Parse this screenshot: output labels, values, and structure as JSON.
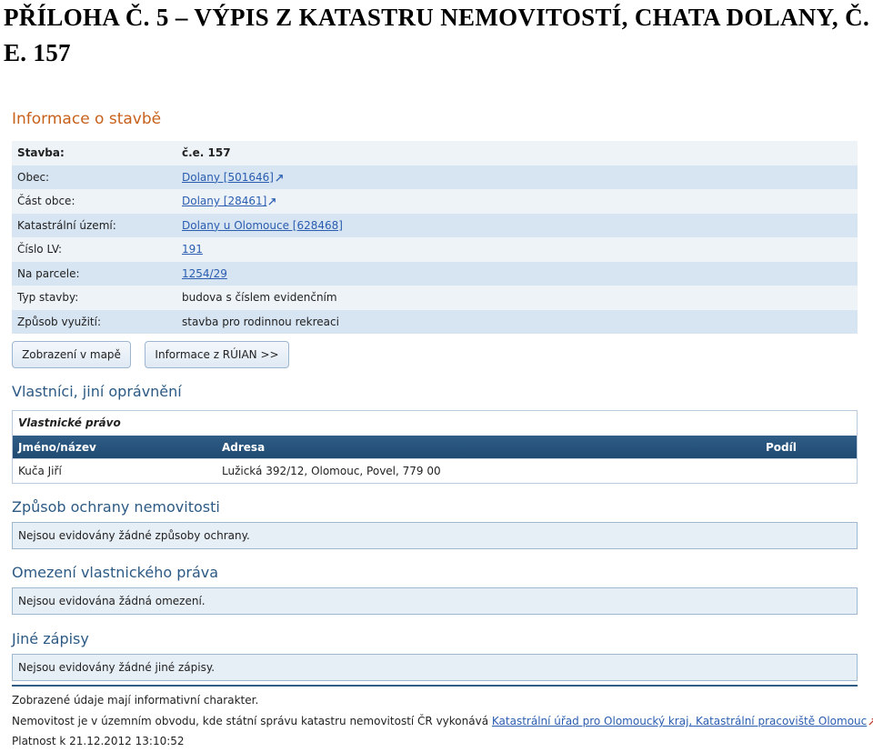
{
  "document": {
    "title": "PŘÍLOHA Č. 5 – VÝPIS Z KATASTRU NEMOVITOSTÍ, CHATA DOLANY, Č. E. 157"
  },
  "building_info": {
    "heading": "Informace o stavbě",
    "rows": [
      {
        "label": "Stavba:",
        "value": "č.e. 157",
        "link": false
      },
      {
        "label": "Obec:",
        "value": "Dolany [501646]",
        "link": true,
        "ext": true
      },
      {
        "label": "Část obce:",
        "value": "Dolany [28461]",
        "link": true,
        "ext": true
      },
      {
        "label": "Katastrální území:",
        "value": "Dolany u Olomouce [628468]",
        "link": true,
        "ext": false
      },
      {
        "label": "Číslo LV:",
        "value": "191",
        "link": true,
        "ext": false
      },
      {
        "label": "Na parcele:",
        "value": "1254/29",
        "link": true,
        "ext": false
      },
      {
        "label": "Typ stavby:",
        "value": "budova s číslem evidenčním",
        "link": false
      },
      {
        "label": "Způsob využití:",
        "value": "stavba pro rodinnou rekreaci",
        "link": false
      }
    ]
  },
  "buttons": {
    "map_label": "Zobrazení v mapě",
    "ruian_label": "Informace z RÚIAN >>"
  },
  "owners": {
    "heading": "Vlastníci, jiní oprávnění",
    "caption": "Vlastnické právo",
    "columns": [
      "Jméno/název",
      "Adresa",
      "Podíl"
    ],
    "rows": [
      {
        "name": "Kuča Jiří",
        "address": "Lužická 392/12, Olomouc, Povel, 779 00",
        "share": ""
      }
    ]
  },
  "protection": {
    "heading": "Způsob ochrany nemovitosti",
    "text": "Nejsou evidovány žádné způsoby ochrany."
  },
  "restrictions": {
    "heading": "Omezení vlastnického práva",
    "text": "Nejsou evidována žádná omezení."
  },
  "other_records": {
    "heading": "Jiné zápisy",
    "text": "Nejsou evidovány žádné jiné zápisy."
  },
  "footer": {
    "informative": "Zobrazené údaje mají informativní charakter.",
    "authority_prefix": "Nemovitost je v územním obvodu, kde státní správu katastru nemovitostí ČR vykonává",
    "authority_link": "Katastrální úřad pro Olomoucký kraj, Katastrální pracoviště Olomouc",
    "validity": "Platnost k 21.12.2012 13:10:52"
  },
  "colors": {
    "heading_blue": "#2c5a84",
    "heading_orange": "#c8611c",
    "link": "#2a5db0",
    "table_header": "#1f4a72"
  }
}
